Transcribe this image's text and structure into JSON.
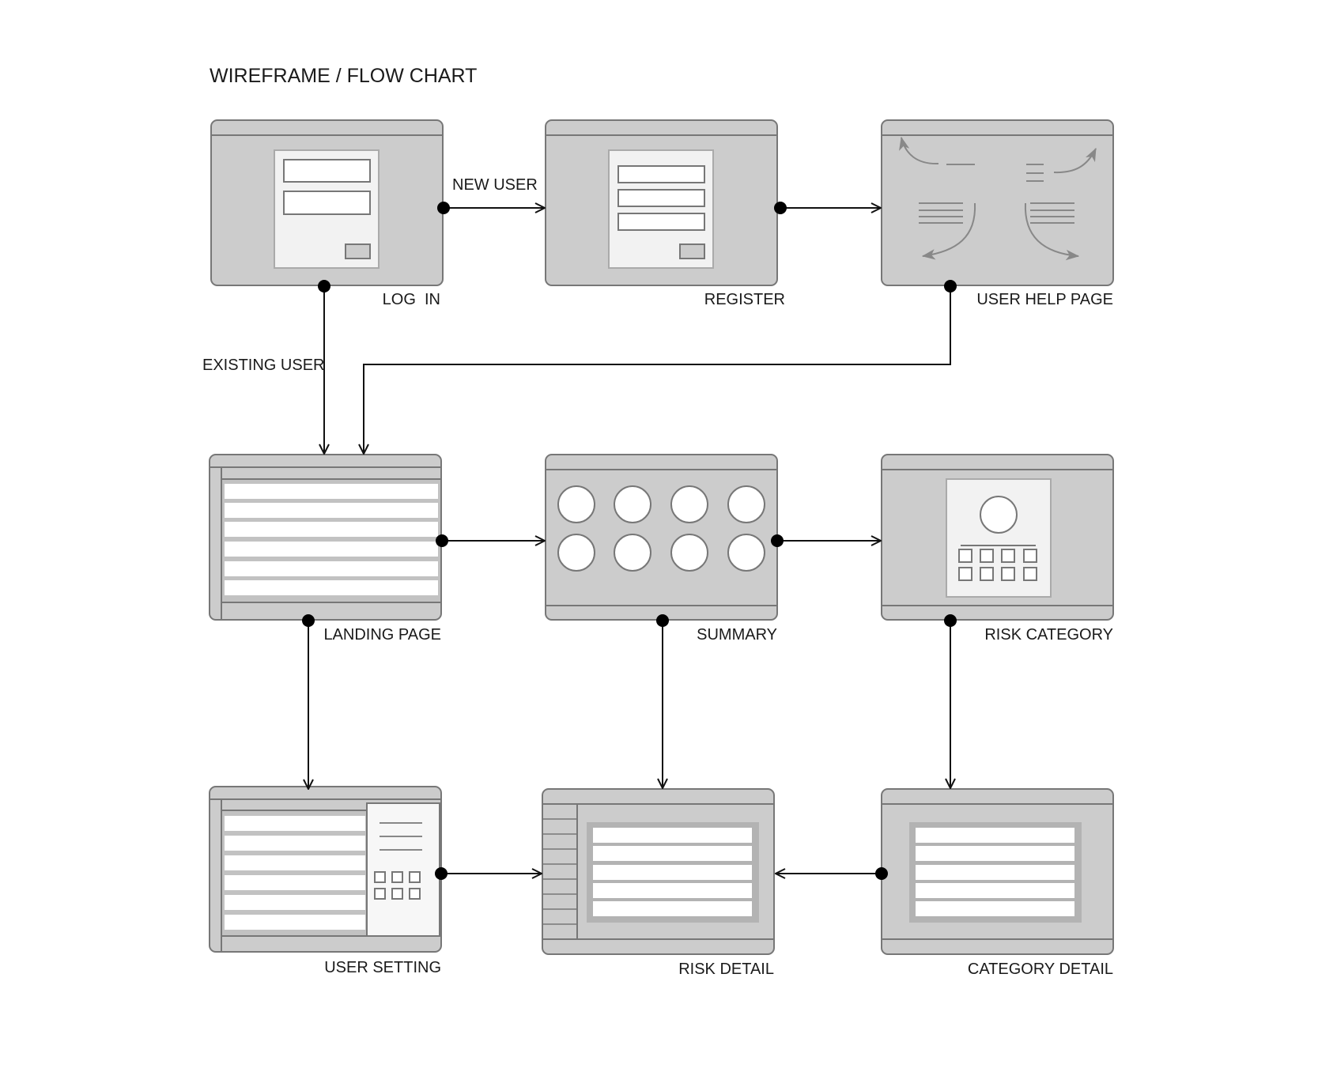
{
  "title": "WIREFRAME / FLOW CHART",
  "screens": {
    "login": {
      "label": "LOG  IN"
    },
    "register": {
      "label": "REGISTER"
    },
    "help": {
      "label": "USER HELP PAGE"
    },
    "landing": {
      "label": "LANDING PAGE"
    },
    "summary": {
      "label": "SUMMARY"
    },
    "risk_category": {
      "label": "RISK CATEGORY"
    },
    "user_setting": {
      "label": "USER SETTING"
    },
    "risk_detail": {
      "label": "RISK DETAIL"
    },
    "category_detail": {
      "label": "CATEGORY DETAIL"
    }
  },
  "flows": {
    "new_user": "NEW USER",
    "existing_user": "EXISTING USER"
  },
  "colors": {
    "frame_fill": "#cccccc",
    "frame_stroke": "#777777",
    "panel_fill": "#f2f2f2",
    "row_fill": "#ffffff",
    "row_gap": "#b5b5b5",
    "line": "#111111",
    "icon_gray": "#888888"
  }
}
